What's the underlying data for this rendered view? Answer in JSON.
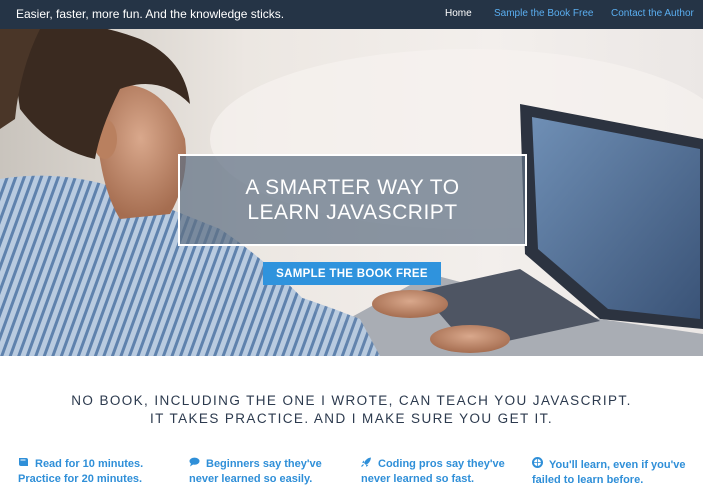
{
  "nav": {
    "brand": "Easier, faster, more fun. And the knowledge sticks.",
    "links": [
      "Home",
      "Sample the Book Free",
      "Contact the Author"
    ]
  },
  "hero": {
    "title_line1": "A SMARTER WAY TO",
    "title_line2": "LEARN JAVASCRIPT",
    "cta": "SAMPLE THE BOOK FREE"
  },
  "tagline": {
    "line1": "NO BOOK, INCLUDING THE ONE I WROTE, CAN TEACH YOU JAVASCRIPT.",
    "line2": "IT TAKES PRACTICE. AND I MAKE SURE YOU GET IT."
  },
  "features": [
    {
      "icon": "book-icon",
      "line1": "Read for 10 minutes.",
      "line2": "Practice for 20 minutes."
    },
    {
      "icon": "speech-bubble-icon",
      "line1": "Beginners say they've",
      "line2": "never learned so easily."
    },
    {
      "icon": "rocket-icon",
      "line1": "Coding pros say they've",
      "line2": "never learned so fast."
    },
    {
      "icon": "lifebuoy-icon",
      "line1": "You'll learn, even if you've",
      "line2": "failed to learn before."
    }
  ],
  "colors": {
    "navbar": "#253446",
    "accent": "#2f93dd",
    "link": "#5aaef0",
    "text_dark": "#2c3a4e"
  }
}
